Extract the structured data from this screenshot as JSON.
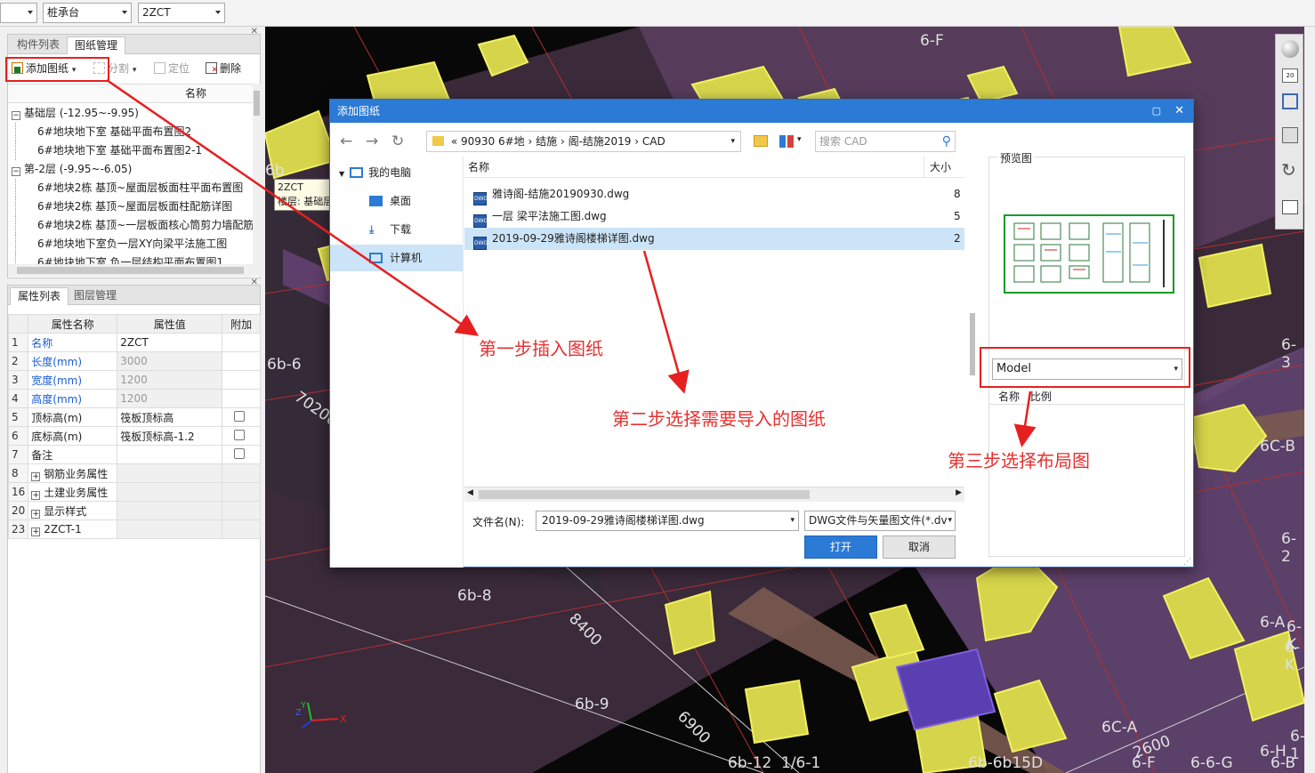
{
  "toolbar": {
    "combo1": "",
    "combo2": "桩承台",
    "combo3": "2ZCT"
  },
  "drawing_panel": {
    "tabs": [
      "构件列表",
      "图纸管理"
    ],
    "buttons": {
      "add": "添加图纸",
      "split": "分割",
      "locate": "定位",
      "delete": "删除"
    },
    "column_header": "名称",
    "tree": [
      {
        "label": "基础层 (-12.95~-9.95)",
        "expand": "−",
        "level": 0
      },
      {
        "label": "6#地块地下室 基础平面布置图2",
        "level": 1
      },
      {
        "label": "6#地块地下室 基础平面布置图2-1",
        "level": 1
      },
      {
        "label": "第-2层 (-9.95~-6.05)",
        "expand": "−",
        "level": 0
      },
      {
        "label": "6#地块2栋 基顶~屋面层板面柱平面布置图",
        "level": 1
      },
      {
        "label": "6#地块2栋 基顶~屋面层板面柱配筋详图",
        "level": 1
      },
      {
        "label": "6#地块2栋 基顶~一层板面核心筒剪力墙配筋",
        "level": 1
      },
      {
        "label": "6#地块地下室负一层XY向梁平法施工图",
        "level": 1
      },
      {
        "label": "6#地块地下室 负一层结构平面布置图1",
        "level": 1
      }
    ]
  },
  "props_panel": {
    "tabs": [
      "属性列表",
      "图层管理"
    ],
    "headers": [
      "属性名称",
      "属性值",
      "附加"
    ],
    "rows": [
      {
        "num": "1",
        "name": "名称",
        "value": "2ZCT",
        "blue": true,
        "gray": false,
        "check": false,
        "expand": ""
      },
      {
        "num": "2",
        "name": "长度(mm)",
        "value": "3000",
        "blue": true,
        "gray": true,
        "check": false,
        "expand": ""
      },
      {
        "num": "3",
        "name": "宽度(mm)",
        "value": "1200",
        "blue": true,
        "gray": true,
        "check": false,
        "expand": ""
      },
      {
        "num": "4",
        "name": "高度(mm)",
        "value": "1200",
        "blue": true,
        "gray": true,
        "check": false,
        "expand": ""
      },
      {
        "num": "5",
        "name": "顶标高(m)",
        "value": "筏板顶标高",
        "blue": false,
        "gray": false,
        "check": true,
        "expand": ""
      },
      {
        "num": "6",
        "name": "底标高(m)",
        "value": "筏板顶标高-1.2",
        "blue": false,
        "gray": false,
        "check": true,
        "expand": ""
      },
      {
        "num": "7",
        "name": "备注",
        "value": "",
        "blue": false,
        "gray": false,
        "check": true,
        "expand": ""
      },
      {
        "num": "8",
        "name": "钢筋业务属性",
        "value": "",
        "blue": false,
        "gray": true,
        "check": false,
        "expand": "+"
      },
      {
        "num": "16",
        "name": "土建业务属性",
        "value": "",
        "blue": false,
        "gray": true,
        "check": false,
        "expand": "+"
      },
      {
        "num": "20",
        "name": "显示样式",
        "value": "",
        "blue": false,
        "gray": true,
        "check": false,
        "expand": "+"
      },
      {
        "num": "23",
        "name": "2ZCT-1",
        "value": "",
        "blue": false,
        "gray": true,
        "check": false,
        "expand": "+"
      }
    ]
  },
  "tooltip": {
    "line1": "2ZCT",
    "line2": "楼层: 基础层"
  },
  "viewport_labels": [
    "6-F",
    "6b",
    "6b-6",
    "70200",
    "6-3",
    "6C-B",
    "6-2",
    "6b-8",
    "8400",
    "6b-9",
    "6900",
    "6b-12",
    "1/6-1",
    "6C-A",
    "2600",
    "6-1",
    "6b-6b15D",
    "6-H",
    "6-F",
    "6-6-G",
    "6-B",
    "6-K",
    "6-A",
    "6-K"
  ],
  "dialog": {
    "title": "添加图纸",
    "path": [
      "« 90930 6#地",
      "结施",
      "阁-结施2019",
      "CAD"
    ],
    "search_placeholder": "搜索 CAD",
    "nav": [
      "我的电脑",
      "桌面",
      "下载",
      "计算机"
    ],
    "file_headers": {
      "name": "名称",
      "size": "大小"
    },
    "files": [
      {
        "name": "雅诗阁-结施20190930.dwg",
        "size": "8",
        "selected": false
      },
      {
        "name": "一层 梁平法施工图.dwg",
        "size": "5",
        "selected": false
      },
      {
        "name": "2019-09-29雅诗阁楼梯详图.dwg",
        "size": "2",
        "selected": true
      }
    ],
    "filename_label": "文件名(N):",
    "filename_value": "2019-09-29雅诗阁楼梯详图.dwg",
    "filetype": "DWG文件与矢量图文件(*.dv",
    "open_label": "打开",
    "cancel_label": "取消",
    "preview_label": "预览图",
    "layout_select": "Model",
    "layout_headers": [
      "名称",
      "比例"
    ]
  },
  "annotations": {
    "step1": "第一步插入图纸",
    "step2": "第二步选择需要导入的图纸",
    "step3": "第三步选择布局图"
  },
  "colors": {
    "accent": "#2b7ad6",
    "annotation": "#e63030",
    "selection": "#cce4f7"
  }
}
